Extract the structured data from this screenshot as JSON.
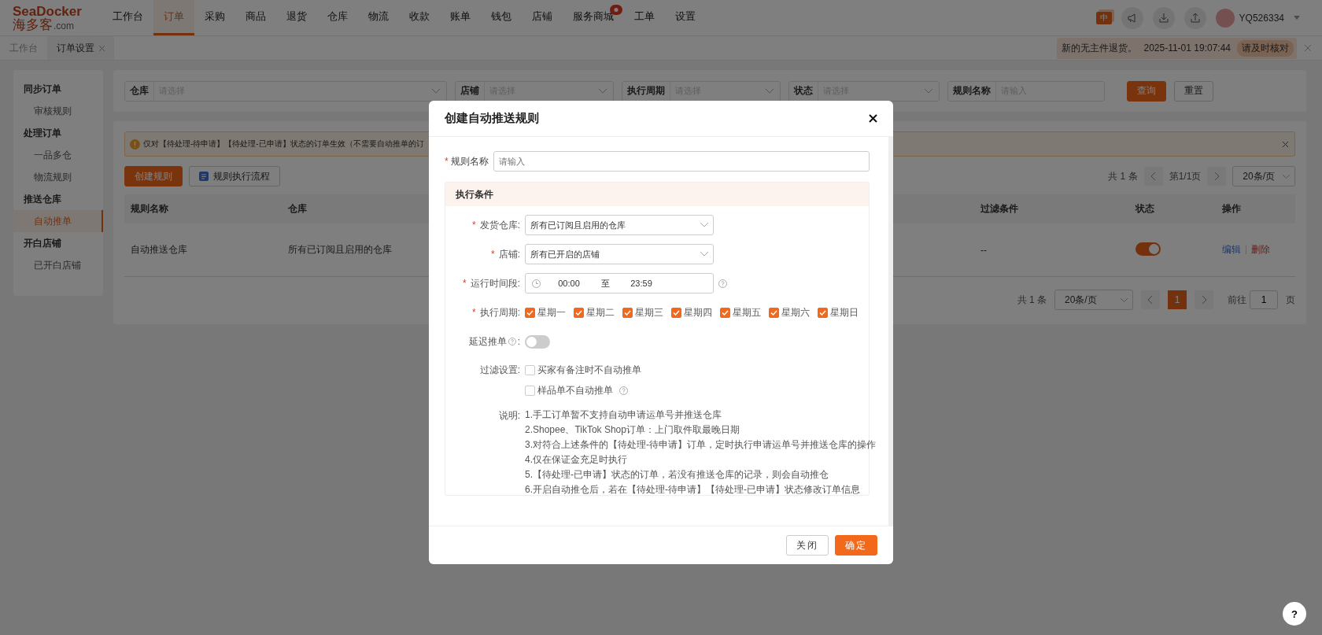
{
  "nav": {
    "logo_top": "SeaDocker",
    "logo_bottom": "海多客",
    "logo_suffix": ".com",
    "items": [
      {
        "label": "工作台",
        "selected": false,
        "badge": false
      },
      {
        "label": "订单",
        "selected": true,
        "badge": false
      },
      {
        "label": "采购",
        "selected": false,
        "badge": false
      },
      {
        "label": "商品",
        "selected": false,
        "badge": false
      },
      {
        "label": "退货",
        "selected": false,
        "badge": false
      },
      {
        "label": "仓库",
        "selected": false,
        "badge": false
      },
      {
        "label": "物流",
        "selected": false,
        "badge": false
      },
      {
        "label": "收款",
        "selected": false,
        "badge": false
      },
      {
        "label": "账单",
        "selected": false,
        "badge": false
      },
      {
        "label": "钱包",
        "selected": false,
        "badge": false
      },
      {
        "label": "店铺",
        "selected": false,
        "badge": false
      },
      {
        "label": "服务商城",
        "selected": false,
        "badge": true
      },
      {
        "label": "工单",
        "selected": false,
        "badge": false
      },
      {
        "label": "设置",
        "selected": false,
        "badge": false
      }
    ],
    "language": {
      "label": "中",
      "selected": true
    },
    "user": "YQ526334"
  },
  "tabs": [
    {
      "label": "工作台",
      "selected": false,
      "closable": false
    },
    {
      "label": "订单设置",
      "selected": true,
      "closable": true
    }
  ],
  "notice": {
    "text": "新的无主件退货。",
    "time": "2025-11-01 19:07:44",
    "action": "请及时核对"
  },
  "sidebar": [
    {
      "title": "同步订单",
      "children": [
        {
          "label": "审核规则",
          "selected": false
        }
      ]
    },
    {
      "title": "处理订单",
      "children": [
        {
          "label": "一品多仓",
          "selected": false
        },
        {
          "label": "物流规则",
          "selected": false
        }
      ]
    },
    {
      "title": "推送仓库",
      "children": [
        {
          "label": "自动推单",
          "selected": true
        }
      ]
    },
    {
      "title": "开白店铺",
      "children": [
        {
          "label": "已开白店铺",
          "selected": false
        }
      ]
    }
  ],
  "filters": [
    {
      "label": "仓库",
      "placeholder": "请选择",
      "kind": "select"
    },
    {
      "label": "店铺",
      "placeholder": "请选择",
      "kind": "select"
    },
    {
      "label": "执行周期",
      "placeholder": "请选择",
      "kind": "select"
    },
    {
      "label": "状态",
      "placeholder": "请选择",
      "kind": "select"
    },
    {
      "label": "规则名称",
      "placeholder": "请输入",
      "kind": "input"
    }
  ],
  "filter_buttons": {
    "query": "查询",
    "reset": "重置"
  },
  "alert": "仅对【待处理-待申请】【待处理-已申请】状态的订单生效（不需要自动推单的订",
  "toolbar": {
    "create": "创建规则",
    "flow": "规则执行流程"
  },
  "pager_top": {
    "total": "共 1 条",
    "page": "第1/1页",
    "size": "20条/页"
  },
  "table": {
    "columns": [
      "规则名称",
      "仓库",
      "过滤条件",
      "状态",
      "操作"
    ],
    "rows": [
      {
        "name": "自动推送仓库",
        "warehouse": "所有已订阅且启用的仓库",
        "filter": "--",
        "enabled": true,
        "edit": "编辑",
        "delete": "删除"
      }
    ]
  },
  "pager_bottom": {
    "total": "共 1 条",
    "size": "20条/页",
    "pages": [
      {
        "label": "1",
        "selected": true
      }
    ],
    "goto": "前往",
    "goto_value": "1",
    "page_unit": "页"
  },
  "modal": {
    "title": "创建自动推送规则",
    "name_field": {
      "label": "规则名称",
      "placeholder": "请输入",
      "required_mark": "*"
    },
    "section": "执行条件",
    "warehouse": {
      "label": "发货仓库:",
      "value": "所有已订阅且启用的仓库",
      "required_mark": "*"
    },
    "shop": {
      "label": "店铺:",
      "value": "所有已开启的店铺",
      "required_mark": "*"
    },
    "time": {
      "label": "运行时间段:",
      "start": "00:00",
      "separator": "至",
      "end": "23:59",
      "required_mark": "*"
    },
    "period": {
      "label": "执行周期:",
      "required_mark": "*",
      "days": [
        {
          "label": "星期一",
          "checked": true
        },
        {
          "label": "星期二",
          "checked": true
        },
        {
          "label": "星期三",
          "checked": true
        },
        {
          "label": "星期四",
          "checked": true
        },
        {
          "label": "星期五",
          "checked": true
        },
        {
          "label": "星期六",
          "checked": true
        },
        {
          "label": "星期日",
          "checked": true
        }
      ]
    },
    "delay": {
      "label": "延迟推单",
      "colon": ":",
      "on": false
    },
    "filter": {
      "label": "过滤设置:",
      "options": [
        {
          "label": "买家有备注时不自动推单",
          "checked": false,
          "help": false
        },
        {
          "label": "样品单不自动推单",
          "checked": false,
          "help": true
        }
      ]
    },
    "notes": {
      "label": "说明:",
      "lines": [
        "1.手工订单暂不支持自动申请运单号并推送仓库",
        "2.Shopee、TikTok Shop订单：上门取件取最晚日期",
        "3.对符合上述条件的【待处理-待申请】订单，定时执行申请运单号并推送仓库的操作",
        "4.仅在保证金充足时执行",
        "5.【待处理-已申请】状态的订单，若没有推送仓库的记录，则会自动推仓",
        "6.开启自动推仓后，若在【待处理-待申请】【待处理-已申请】状态修改订单信息"
      ]
    },
    "buttons": {
      "close": "关闭",
      "confirm": "确定"
    }
  },
  "help_button": "?"
}
